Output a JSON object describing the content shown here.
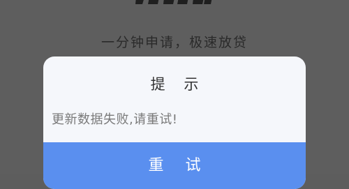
{
  "background": {
    "tagline": "一分钟申请，极速放贷",
    "logo": "brand-logo"
  },
  "dialog": {
    "title": "提 示",
    "message": "更新数据失败,请重试!",
    "retry_label": "重 试"
  },
  "colors": {
    "overlay": "#5e5e5e",
    "dialog_bg": "#f5f7fb",
    "button_bg": "#5a8fef",
    "button_text": "#ffffff",
    "title_text": "#333333",
    "message_text": "#7a7a7a"
  }
}
